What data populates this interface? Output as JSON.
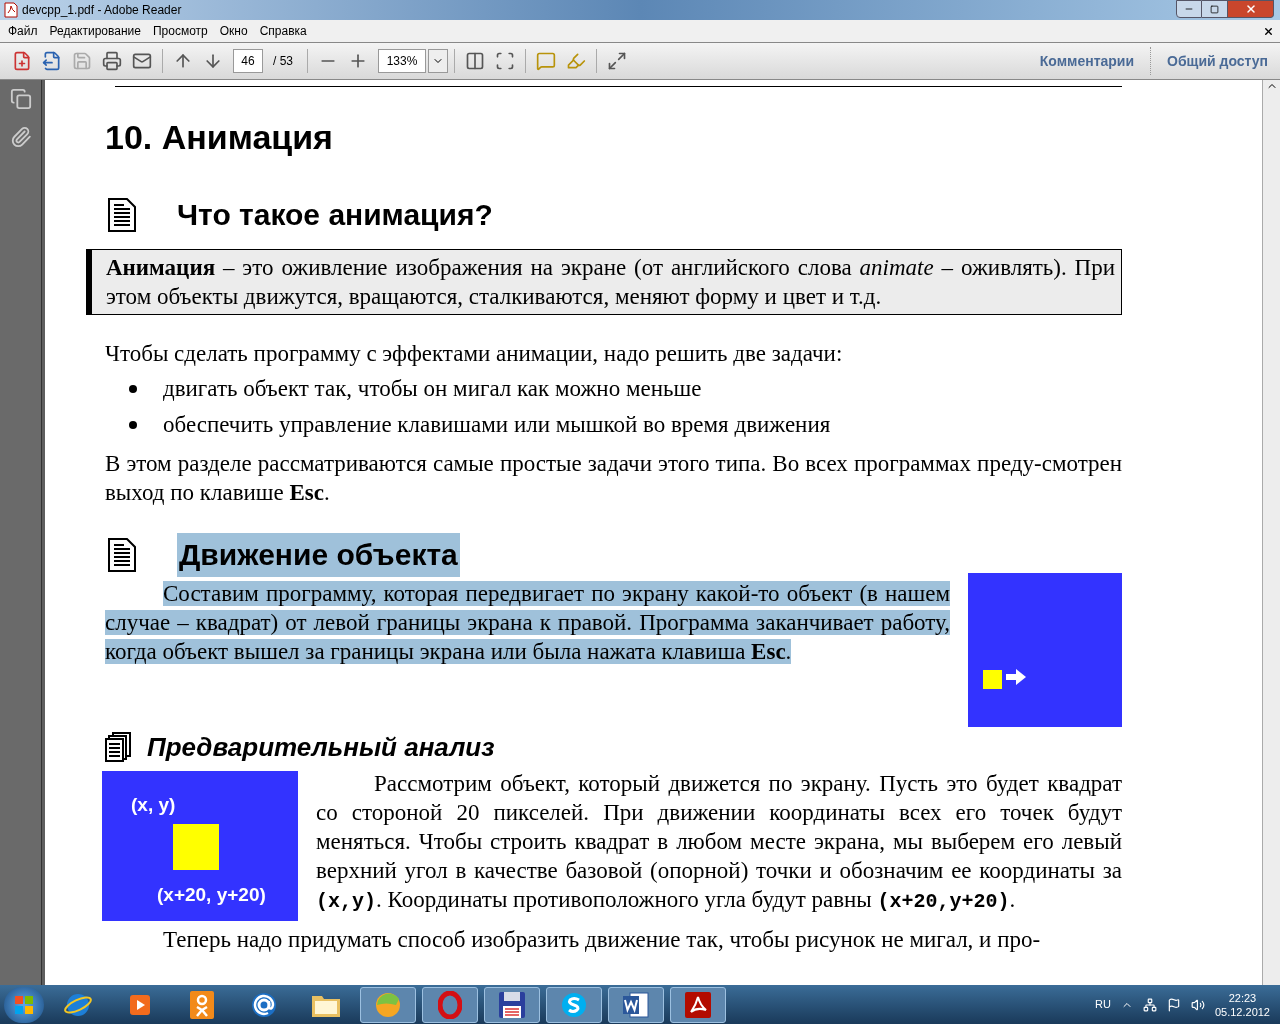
{
  "window": {
    "title": "devcpp_1.pdf - Adobe Reader"
  },
  "menu": [
    "Файл",
    "Редактирование",
    "Просмотр",
    "Окно",
    "Справка"
  ],
  "toolbar": {
    "page_current": "46",
    "page_total": "/ 53",
    "zoom": "133%",
    "links": [
      "Комментарии",
      "Общий доступ"
    ]
  },
  "document": {
    "chapter": "10.  Анимация",
    "section1": {
      "heading": "Что такое анимация?",
      "definition": "**Анимация** – это оживление изображения на экране (от английского слова *animate* – оживлять). При этом объекты движутся, вращаются, сталкиваются, меняют форму и цвет и т.д.",
      "intro": "Чтобы сделать программу с эффектами анимации, надо решить две задачи:",
      "bullets": [
        "двигать объект так, чтобы он мигал как можно меньше",
        "обеспечить управление клавишами или мышкой во время движения"
      ],
      "outro": "В этом разделе рассматриваются самые простые задачи этого типа. Во всех программах преду-смотрен выход по клавише **Esc**."
    },
    "section2": {
      "heading": "Движение объекта",
      "heading_selected": true,
      "text": "Составим программу, которая передвигает по экрану какой-то объект (в нашем случае – квадрат) от левой границы экрана к правой. Программа заканчивает работу, когда объект вышел за границы экрана или была нажата клавиша **Esc**.",
      "text_selected": true
    },
    "section3": {
      "heading": "Предварительный анализ",
      "figure_labels": [
        "(x, y)",
        "(x+20, y+20)"
      ],
      "runs": [
        {
          "kind": "text",
          "text": "Рассмотрим объект, который движется по экрану. Пусть это будет квадрат со стороной 20 пикселей. При движении координаты всех его точек будут меняться. Чтобы строить квадрат в любом месте экрана, мы выберем его левый верхний угол в качестве базовой (опорной) точки и обозначим ее координаты за "
        },
        {
          "kind": "code",
          "text": "(x,y)"
        },
        {
          "kind": "text",
          "text": ". Координаты противоположного угла будут равны "
        },
        {
          "kind": "code",
          "text": "(x+20,y+20)"
        },
        {
          "kind": "text",
          "text": "."
        }
      ],
      "cut_line": "Теперь надо придумать способ изобразить движение так, чтобы рисунок не мигал, и про-"
    }
  },
  "taskbar": {
    "apps": [
      {
        "kind": "ie",
        "running": false
      },
      {
        "kind": "media",
        "running": false
      },
      {
        "kind": "ok",
        "running": false
      },
      {
        "kind": "mail",
        "running": false
      },
      {
        "kind": "folder",
        "running": false
      },
      {
        "kind": "ball",
        "running": true
      },
      {
        "kind": "opera",
        "running": true
      },
      {
        "kind": "floppy",
        "running": true
      },
      {
        "kind": "skype",
        "running": true
      },
      {
        "kind": "word",
        "running": true
      },
      {
        "kind": "reader",
        "running": true
      }
    ],
    "language": "RU",
    "time": "22:23",
    "date": "05.12.2012"
  }
}
